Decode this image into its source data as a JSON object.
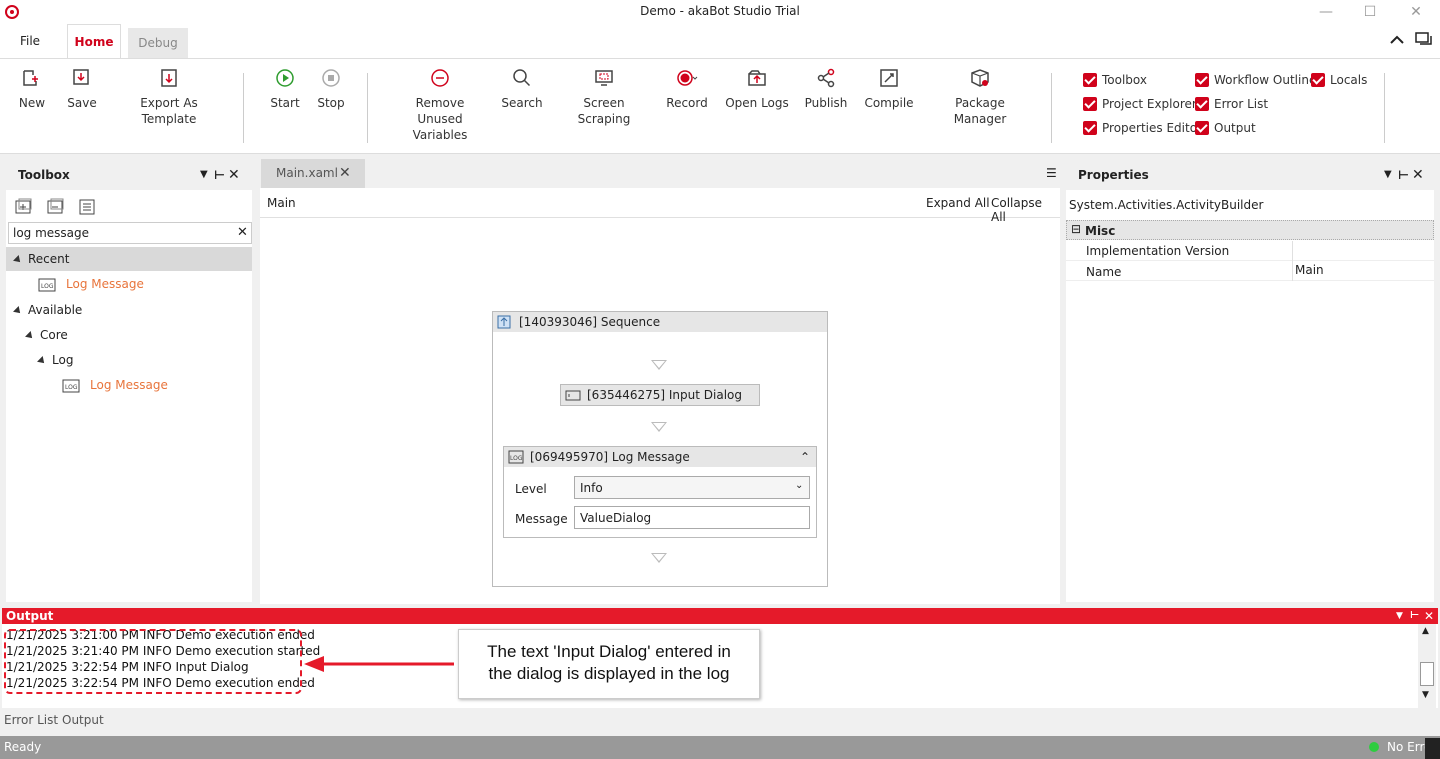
{
  "window": {
    "title": "Demo - akaBot Studio Trial"
  },
  "ribbon_tabs": {
    "file": "File",
    "home": "Home",
    "debug": "Debug"
  },
  "ribbon": {
    "new": "New",
    "save": "Save",
    "export": "Export As Template",
    "start": "Start",
    "stop": "Stop",
    "remove_unused_1": "Remove Unused",
    "remove_unused_2": "Variables",
    "search": "Search",
    "screen_scraping": "Screen Scraping",
    "record": "Record",
    "open_logs": "Open Logs",
    "publish": "Publish",
    "compile": "Compile",
    "package_manager": "Package Manager"
  },
  "panels_toggle": {
    "toolbox": "Toolbox",
    "workflow_outline": "Workflow Outline",
    "locals": "Locals",
    "project_explorer": "Project Explorer",
    "error_list": "Error List",
    "properties_editor": "Properties Editor",
    "output": "Output"
  },
  "toolbox": {
    "title": "Toolbox",
    "search_value": "log message",
    "recent": "Recent",
    "recent_item": "Log Message",
    "available": "Available",
    "core": "Core",
    "log": "Log",
    "log_item": "Log Message"
  },
  "designer": {
    "tab": "Main.xaml",
    "breadcrumb": "Main",
    "expand_all": "Expand All",
    "collapse_all": "Collapse All",
    "sequence_title": "[140393046] Sequence",
    "input_dialog_title": "[635446275] Input Dialog",
    "log_message_title": "[069495970] Log Message",
    "level_label": "Level",
    "level_value": "Info",
    "message_label": "Message",
    "message_value": "ValueDialog"
  },
  "properties": {
    "title": "Properties",
    "object": "System.Activities.ActivityBuilder",
    "category": "Misc",
    "rows": [
      {
        "name": "Implementation Version",
        "value": ""
      },
      {
        "name": "Name",
        "value": "Main"
      }
    ]
  },
  "output": {
    "title": "Output",
    "lines": [
      "1/21/2025 3:21:00 PM INFO Demo execution ended",
      "1/21/2025 3:21:40 PM INFO Demo execution started",
      "1/21/2025 3:22:54 PM INFO Input Dialog",
      "1/21/2025 3:22:54 PM INFO Demo execution ended"
    ]
  },
  "callout": {
    "line1": "The text 'Input Dialog' entered in",
    "line2": "the dialog is displayed in the log"
  },
  "bottom_tabs": {
    "error_list": "Error List",
    "output": "Output"
  },
  "status": {
    "ready": "Ready",
    "errors": "No Erro"
  },
  "colors": {
    "accent": "#d0021b",
    "output_bar": "#e51a2a",
    "toolbox_item": "#e8743b"
  }
}
